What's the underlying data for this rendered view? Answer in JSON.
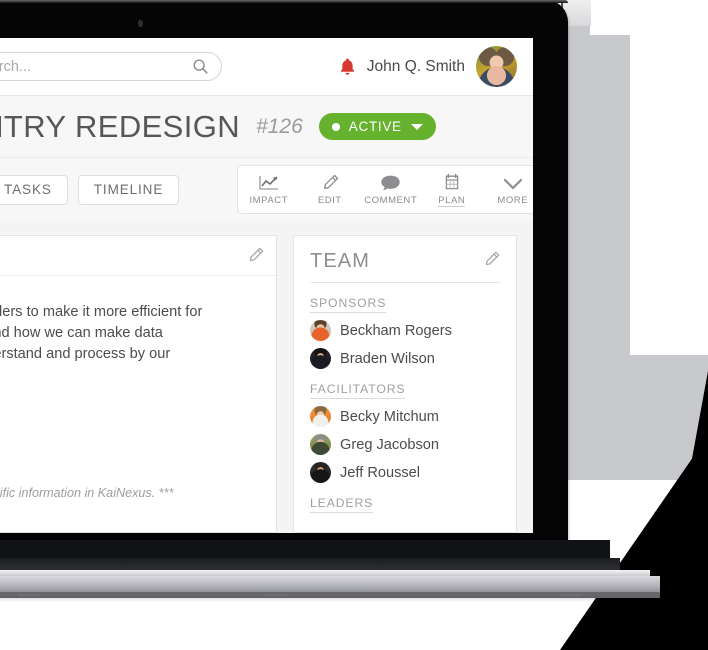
{
  "app": {
    "search": {
      "placeholder": "Search...",
      "value": ""
    },
    "user": {
      "name": "John Q. Smith",
      "avatar_icon": "user-photo-avatar"
    },
    "notification_icon": "bell-icon",
    "search_icon": "magnifier-icon",
    "bell_color": "#d8372f"
  },
  "page": {
    "title": "ENTRY REDESIGN",
    "entry_id": "#126",
    "status": {
      "label": "ACTIVE",
      "color": "#66b22e",
      "dot_icon": "status-dot-icon",
      "caret_icon": "chevron-down-icon"
    }
  },
  "tabs": [
    {
      "label": "",
      "name": "tab-stub"
    },
    {
      "label": "TASKS",
      "name": "tab-tasks"
    },
    {
      "label": "TIMELINE",
      "name": "tab-timeline"
    }
  ],
  "toolbar": [
    {
      "label": "IMPACT",
      "icon": "chart-line-icon",
      "underlined": false
    },
    {
      "label": "EDIT",
      "icon": "pencil-icon",
      "underlined": false
    },
    {
      "label": "COMMENT",
      "icon": "speech-bubble-icon",
      "underlined": false
    },
    {
      "label": "PLAN",
      "icon": "calendar-icon",
      "underlined": true
    },
    {
      "label": "MORE",
      "icon": "chevron-down-icon",
      "underlined": false
    }
  ],
  "description": {
    "edit_icon": "pencil-icon",
    "lines": [
      "g orders to make it more efficient for",
      "rstand how we can make data",
      "understand and process by our"
    ],
    "note": "-specific information in KaiNexus. ***"
  },
  "team": {
    "title": "TEAM",
    "edit_icon": "pencil-icon",
    "groups": [
      {
        "label": "SPONSORS",
        "members": [
          {
            "name": "Beckham Rogers",
            "avatar": "av-beckham"
          },
          {
            "name": "Braden Wilson",
            "avatar": "av-braden"
          }
        ]
      },
      {
        "label": "FACILITATORS",
        "members": [
          {
            "name": "Becky Mitchum",
            "avatar": "av-becky"
          },
          {
            "name": "Greg Jacobson",
            "avatar": "av-greg"
          },
          {
            "name": "Jeff Roussel",
            "avatar": "av-jeff"
          }
        ]
      },
      {
        "label": "LEADERS",
        "members": []
      }
    ]
  },
  "device": {
    "type": "laptop",
    "webcam_icon": "webcam-dot-icon"
  }
}
